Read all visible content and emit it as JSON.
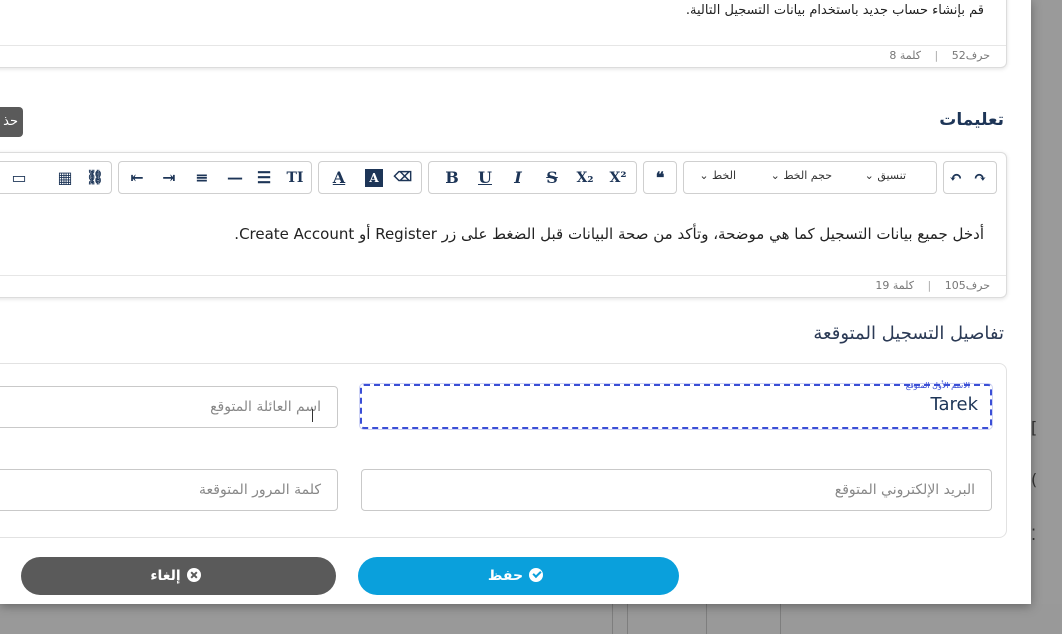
{
  "background": {
    "right_marks": [
      "[",
      "(",
      "⁚"
    ]
  },
  "description_editor": {
    "text": "قم بإنشاء حساب جديد باستخدام بيانات التسجيل التالية.",
    "chars": "حرف52",
    "words": "كلمة 8",
    "separator": "|"
  },
  "side_button": {
    "label": "حذ"
  },
  "instructions": {
    "label": "تعليمات",
    "toolbar": {
      "undo": "↶",
      "redo": "↷",
      "format_select": "تنسيق",
      "size_select": "حجم الخط",
      "font_select": "الخط",
      "blockquote": "❝",
      "superscript": "X²",
      "subscript": "X₂",
      "strike": "S",
      "italic": "I",
      "underline": "U",
      "bold": "B",
      "eraser": "⌫",
      "bg_color": "A",
      "text_color": "A",
      "clear_format": "TI",
      "ordered_list": "☰",
      "hr": "—",
      "align": "≡",
      "indent": "⇥",
      "outdent": "⇤",
      "link": "⛓",
      "table": "▦",
      "layout": "▭"
    },
    "text": "أدخل جميع بيانات التسجيل كما هي موضحة، وتأكد من صحة البيانات قبل الضغط على زر Register أو Create Account.",
    "chars": "حرف105",
    "words": "كلمة 19",
    "separator": "|"
  },
  "details": {
    "label": "تفاصيل التسجيل المتوقعة",
    "first_name": {
      "label": "الاسم الأول المتوقع",
      "value": "Tarek"
    },
    "last_name": {
      "placeholder": "اسم العائلة المتوقع"
    },
    "email": {
      "placeholder": "البريد الإلكتروني المتوقع"
    },
    "password": {
      "placeholder": "كلمة المرور المتوقعة"
    }
  },
  "actions": {
    "save": "حفظ",
    "cancel": "إلغاء"
  },
  "colors": {
    "primary": "#0aa0dc",
    "cancel": "#5a5a5a",
    "focus": "#3b4fd6",
    "heading": "#1d3557"
  }
}
